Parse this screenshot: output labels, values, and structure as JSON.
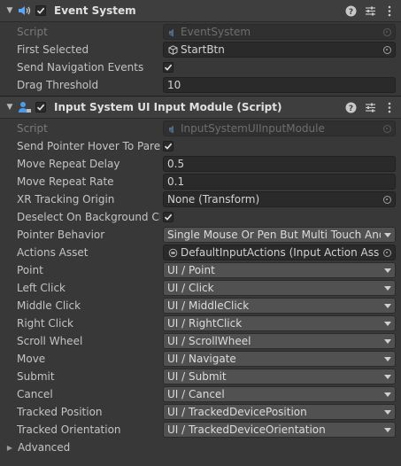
{
  "event_system": {
    "title": "Event System",
    "enabled": true,
    "fields": {
      "script": {
        "label": "Script",
        "value": "EventSystem"
      },
      "first_selected": {
        "label": "First Selected",
        "value": "StartBtn"
      },
      "send_navigation_events": {
        "label": "Send Navigation Events",
        "checked": true
      },
      "drag_threshold": {
        "label": "Drag Threshold",
        "value": "10"
      }
    }
  },
  "input_module": {
    "title": "Input System UI Input Module (Script)",
    "enabled": true,
    "fields": {
      "script": {
        "label": "Script",
        "value": "InputSystemUIInputModule"
      },
      "send_pointer_hover": {
        "label": "Send Pointer Hover To Parent",
        "checked": true
      },
      "move_repeat_delay": {
        "label": "Move Repeat Delay",
        "value": "0.5"
      },
      "move_repeat_rate": {
        "label": "Move Repeat Rate",
        "value": "0.1"
      },
      "xr_tracking_origin": {
        "label": "XR Tracking Origin",
        "value": "None (Transform)"
      },
      "deselect_on_background": {
        "label": "Deselect On Background Click",
        "checked": true
      },
      "pointer_behavior": {
        "label": "Pointer Behavior",
        "value": "Single Mouse Or Pen But Multi Touch And Track"
      },
      "actions_asset": {
        "label": "Actions Asset",
        "value": "DefaultInputActions (Input Action Asset)"
      }
    },
    "actions": [
      {
        "label": "Point",
        "value": "UI / Point"
      },
      {
        "label": "Left Click",
        "value": "UI / Click"
      },
      {
        "label": "Middle Click",
        "value": "UI / MiddleClick"
      },
      {
        "label": "Right Click",
        "value": "UI / RightClick"
      },
      {
        "label": "Scroll Wheel",
        "value": "UI / ScrollWheel"
      },
      {
        "label": "Move",
        "value": "UI / Navigate"
      },
      {
        "label": "Submit",
        "value": "UI / Submit"
      },
      {
        "label": "Cancel",
        "value": "UI / Cancel"
      },
      {
        "label": "Tracked Position",
        "value": "UI / TrackedDevicePosition"
      },
      {
        "label": "Tracked Orientation",
        "value": "UI / TrackedDeviceOrientation"
      }
    ],
    "advanced": {
      "label": "Advanced",
      "expanded": false
    }
  },
  "icons": {
    "fold_open": "triangle-down",
    "fold_closed": "triangle-right",
    "component_event_system": "speaker-icon",
    "component_input_module": "person-icon",
    "help": "help-icon",
    "preset": "sliders-icon",
    "menu": "kebab-icon",
    "script_ref": "script-icon",
    "gameobject_ref": "cube-icon",
    "input_asset_ref": "input-asset-icon",
    "object_picker": "object-picker-icon",
    "dropdown": "dropdown-arrow-icon"
  },
  "colors": {
    "background": "#383838",
    "header": "#3e3e3e",
    "field": "#2a2a2a",
    "dropdown": "#515151",
    "text": "#c4c4c4",
    "disabled_text": "#7a7a7a"
  }
}
